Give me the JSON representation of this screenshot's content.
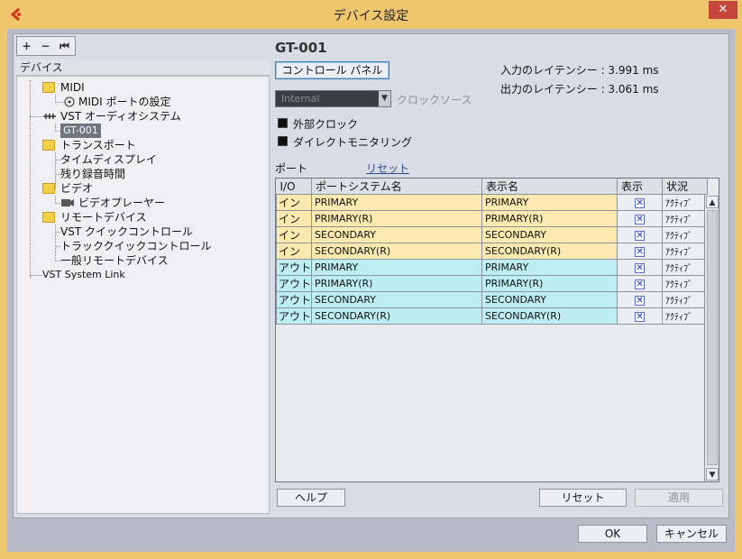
{
  "window": {
    "title": "デバイス設定",
    "close_label": "✕"
  },
  "tree": {
    "toolbar": {
      "add": "+",
      "remove": "−",
      "reset": "⏮"
    },
    "header": "デバイス",
    "items": [
      {
        "label": "MIDI"
      },
      {
        "label": "MIDI ポートの設定"
      },
      {
        "label": "VST オーディオシステム"
      },
      {
        "label": "GT-001"
      },
      {
        "label": "トランスポート"
      },
      {
        "label": "タイムディスプレイ"
      },
      {
        "label": "残り録音時間"
      },
      {
        "label": "ビデオ"
      },
      {
        "label": "ビデオプレーヤー"
      },
      {
        "label": "リモートデバイス"
      },
      {
        "label": "VST クイックコントロール"
      },
      {
        "label": "トラッククイックコントロール"
      },
      {
        "label": "一般リモートデバイス"
      },
      {
        "label": "VST System Link"
      }
    ]
  },
  "device": {
    "name": "GT-001",
    "control_panel_label": "コントロール パネル",
    "input_latency": "入力のレイテンシー : 3.991 ms",
    "output_latency": "出力のレイテンシー : 3.061 ms",
    "clock_source_value": "Internal",
    "clock_source_label": "クロックソース",
    "external_clock_label": "外部クロック",
    "direct_monitoring_label": "ダイレクトモニタリング",
    "ports_label": "ポート",
    "reset_link": "リセット"
  },
  "ports_table": {
    "columns": [
      "I/O",
      "ポートシステム名",
      "表示名",
      "表示",
      "状況"
    ],
    "rows": [
      {
        "io": "イン",
        "system": "PRIMARY",
        "display": "PRIMARY",
        "show": "✕",
        "status": "ｱｸﾃｨﾌﾞ",
        "type": "in"
      },
      {
        "io": "イン",
        "system": "PRIMARY(R)",
        "display": "PRIMARY(R)",
        "show": "✕",
        "status": "ｱｸﾃｨﾌﾞ",
        "type": "in"
      },
      {
        "io": "イン",
        "system": "SECONDARY",
        "display": "SECONDARY",
        "show": "✕",
        "status": "ｱｸﾃｨﾌﾞ",
        "type": "in"
      },
      {
        "io": "イン",
        "system": "SECONDARY(R)",
        "display": "SECONDARY(R)",
        "show": "✕",
        "status": "ｱｸﾃｨﾌﾞ",
        "type": "in"
      },
      {
        "io": "アウト",
        "system": "PRIMARY",
        "display": "PRIMARY",
        "show": "✕",
        "status": "ｱｸﾃｨﾌﾞ",
        "type": "out"
      },
      {
        "io": "アウト",
        "system": "PRIMARY(R)",
        "display": "PRIMARY(R)",
        "show": "✕",
        "status": "ｱｸﾃｨﾌﾞ",
        "type": "out"
      },
      {
        "io": "アウト",
        "system": "SECONDARY",
        "display": "SECONDARY",
        "show": "✕",
        "status": "ｱｸﾃｨﾌﾞ",
        "type": "out"
      },
      {
        "io": "アウト",
        "system": "SECONDARY(R)",
        "display": "SECONDARY(R)",
        "show": "✕",
        "status": "ｱｸﾃｨﾌﾞ",
        "type": "out"
      }
    ]
  },
  "buttons": {
    "help": "ヘルプ",
    "reset": "リセット",
    "apply": "適用",
    "ok": "OK",
    "cancel": "キャンセル"
  },
  "colors": {
    "frame": "#f0c66d",
    "input_row": "#fbe9b0",
    "output_row": "#bdeef3",
    "selected": "#6f7680",
    "close": "#c7463c"
  }
}
